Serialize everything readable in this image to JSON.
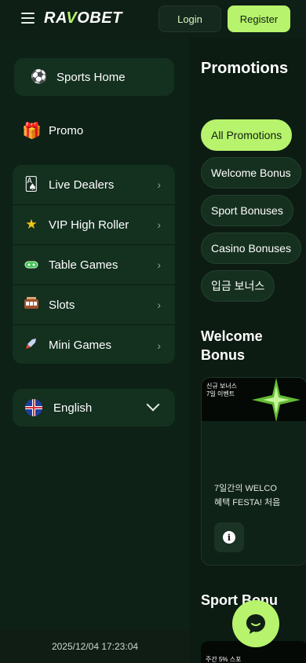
{
  "header": {
    "logo": "RAVOBET",
    "login_label": "Login",
    "register_label": "Register"
  },
  "sidebar": {
    "sports_home": "Sports Home",
    "promo": "Promo",
    "items": [
      {
        "label": "Live Dealers",
        "icon": "cards-icon"
      },
      {
        "label": "VIP High Roller",
        "icon": "star-icon"
      },
      {
        "label": "Table Games",
        "icon": "chip-icon"
      },
      {
        "label": "Slots",
        "icon": "slot-machine-icon"
      },
      {
        "label": "Mini Games",
        "icon": "rocket-icon"
      }
    ],
    "language": "English",
    "timestamp": "2025/12/04 17:23:04"
  },
  "main": {
    "title": "Promotions",
    "chips": [
      {
        "label": "All Promotions",
        "active": true
      },
      {
        "label": "Welcome Bonus"
      },
      {
        "label": "Sport Bonuses"
      },
      {
        "label": "Casino Bonuses"
      },
      {
        "label": "입금 보너스"
      }
    ],
    "welcome_title": "Welcome Bonus",
    "welcome_card": {
      "banner_line1": "신규 보너스",
      "banner_line2": "7일 이벤트",
      "text_line1": "7일간의 WELCO",
      "text_line2": "혜택 FESTA! 처음"
    },
    "sport_title": "Sport Bonu",
    "sport_card": {
      "banner_text": "주간 5% 스포"
    }
  },
  "colors": {
    "accent": "#b7f36c",
    "background": "#0b1a12",
    "sidebar": "#0d2117",
    "card": "#14301f"
  }
}
